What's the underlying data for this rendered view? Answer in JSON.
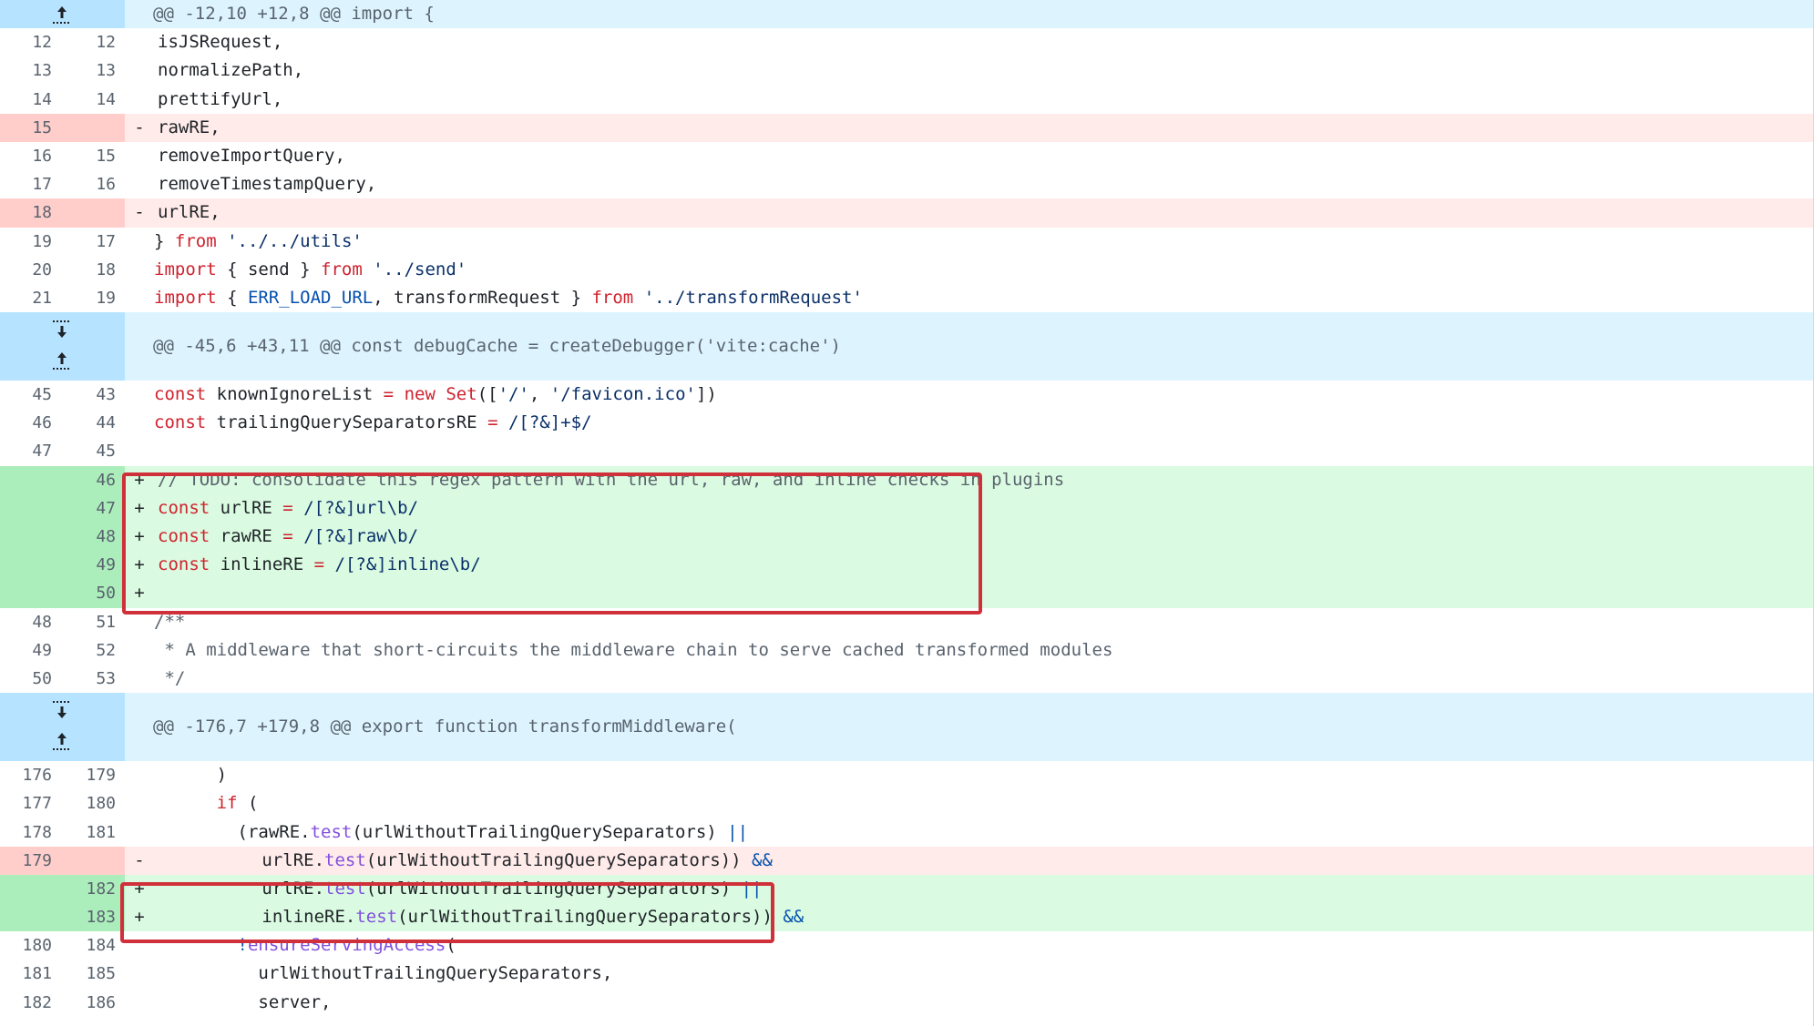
{
  "hunk1": "@@ -12,10 +12,8 @@ import {",
  "hunk2": "@@ -45,6 +43,11 @@ const debugCache = createDebugger('vite:cache')",
  "hunk3": "@@ -176,7 +179,8 @@ export function transformMiddleware(",
  "markers": {
    "del": "-",
    "add": "+"
  },
  "lines": {
    "l1": {
      "old": "12",
      "new": "12",
      "t": [
        "isJSRequest,"
      ]
    },
    "l2": {
      "old": "13",
      "new": "13",
      "t": [
        "normalizePath,"
      ]
    },
    "l3": {
      "old": "14",
      "new": "14",
      "t": [
        "prettifyUrl,"
      ]
    },
    "l4": {
      "old": "15",
      "new": "",
      "t": [
        "rawRE,"
      ]
    },
    "l5": {
      "old": "16",
      "new": "15",
      "t": [
        "removeImportQuery,"
      ]
    },
    "l6": {
      "old": "17",
      "new": "16",
      "t": [
        "removeTimestampQuery,"
      ]
    },
    "l7": {
      "old": "18",
      "new": "",
      "t": [
        "urlRE,"
      ]
    },
    "l8": {
      "old": "19",
      "new": "17",
      "t": [
        "} ",
        "from",
        " ",
        "'../../utils'"
      ]
    },
    "l9": {
      "old": "20",
      "new": "18",
      "t": [
        "import",
        " { send } ",
        "from",
        " ",
        "'../send'"
      ]
    },
    "l10": {
      "old": "21",
      "new": "19",
      "t": [
        "import",
        " { ",
        "ERR_LOAD_URL",
        ", transformRequest } ",
        "from",
        " ",
        "'../transformRequest'"
      ]
    },
    "l11": {
      "old": "45",
      "new": "43",
      "t": [
        "const",
        " knownIgnoreList ",
        "=",
        " ",
        "new",
        " ",
        "Set",
        "([",
        "'/'",
        ", ",
        "'/favicon.ico'",
        "])"
      ]
    },
    "l12": {
      "old": "46",
      "new": "44",
      "t": [
        "const",
        " trailingQuerySeparatorsRE ",
        "=",
        " ",
        "/[?&]+$/"
      ]
    },
    "l13": {
      "old": "47",
      "new": "45",
      "t": [
        ""
      ]
    },
    "l14": {
      "old": "",
      "new": "46",
      "t": [
        "// TODO: consolidate this regex pattern with the url, raw, and inline checks in plugins"
      ]
    },
    "l15": {
      "old": "",
      "new": "47",
      "t": [
        "const",
        " urlRE ",
        "=",
        " ",
        "/[?&]url\\b/"
      ]
    },
    "l16": {
      "old": "",
      "new": "48",
      "t": [
        "const",
        " rawRE ",
        "=",
        " ",
        "/[?&]raw\\b/"
      ]
    },
    "l17": {
      "old": "",
      "new": "49",
      "t": [
        "const",
        " inlineRE ",
        "=",
        " ",
        "/[?&]inline\\b/"
      ]
    },
    "l18": {
      "old": "",
      "new": "50",
      "t": [
        ""
      ]
    },
    "l19": {
      "old": "48",
      "new": "51",
      "t": [
        "/**"
      ]
    },
    "l20": {
      "old": "49",
      "new": "52",
      "t": [
        " * A middleware that short-circuits the middleware chain to serve cached transformed modules"
      ]
    },
    "l21": {
      "old": "50",
      "new": "53",
      "t": [
        " */"
      ]
    },
    "l22": {
      "old": "176",
      "new": "179",
      "t": [
        "      )"
      ]
    },
    "l23": {
      "old": "177",
      "new": "180",
      "t": [
        "      ",
        "if",
        " ("
      ]
    },
    "l24": {
      "old": "178",
      "new": "181",
      "t": [
        "        (rawRE.",
        "test",
        "(urlWithoutTrailingQuerySeparators) ",
        "||"
      ]
    },
    "l25": {
      "old": "179",
      "new": "",
      "t": [
        "          urlRE.",
        "test",
        "(urlWithoutTrailingQuerySeparators)) ",
        "&&"
      ]
    },
    "l26": {
      "old": "",
      "new": "182",
      "t": [
        "          urlRE.",
        "test",
        "(urlWithoutTrailingQuerySeparators) ",
        "||"
      ]
    },
    "l27": {
      "old": "",
      "new": "183",
      "t": [
        "          inlineRE.",
        "test",
        "(urlWithoutTrailingQuerySeparators)) ",
        "&&"
      ]
    },
    "l28": {
      "old": "180",
      "new": "184",
      "t": [
        "        ",
        "!",
        "ensureServingAccess",
        "("
      ]
    },
    "l29": {
      "old": "181",
      "new": "185",
      "t": [
        "          urlWithoutTrailingQuerySeparators,"
      ]
    },
    "l30": {
      "old": "182",
      "new": "186",
      "t": [
        "          server,"
      ]
    }
  }
}
